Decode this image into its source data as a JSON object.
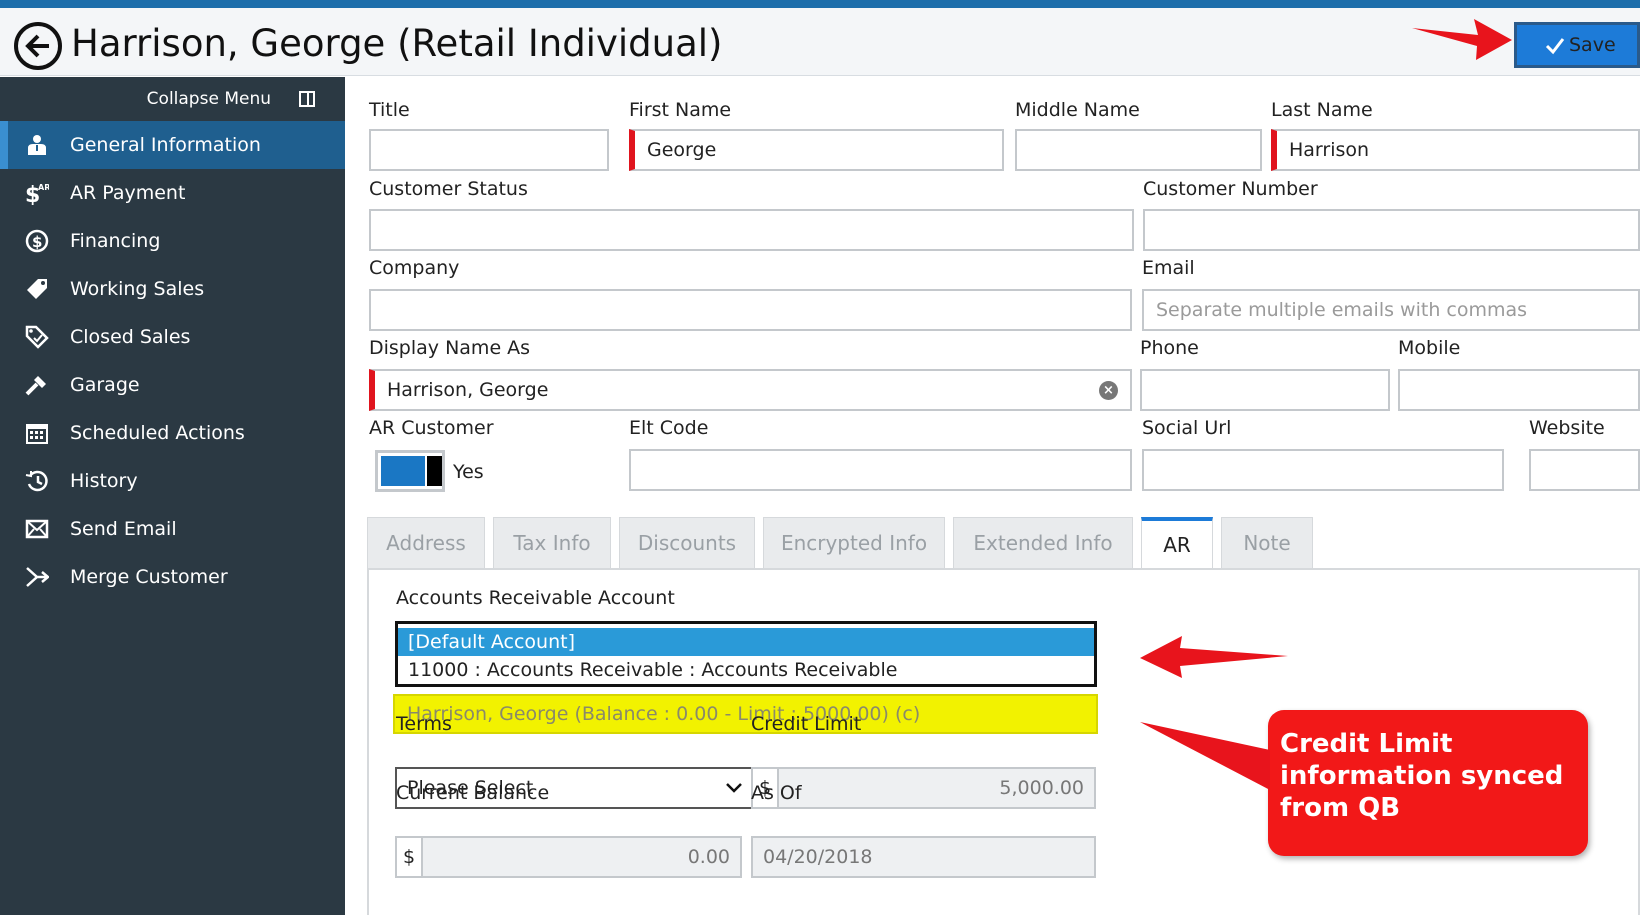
{
  "header": {
    "title": "Harrison, George (Retail Individual)",
    "save_label": "Save"
  },
  "sidebar": {
    "collapse_label": "Collapse Menu",
    "items": [
      {
        "label": "General Information",
        "icon": "person-icon",
        "active": true
      },
      {
        "label": "AR Payment",
        "icon": "ar-dollar-icon"
      },
      {
        "label": "Financing",
        "icon": "dollar-circle-icon"
      },
      {
        "label": "Working Sales",
        "icon": "tag-icon"
      },
      {
        "label": "Closed Sales",
        "icon": "tag-check-icon"
      },
      {
        "label": "Garage",
        "icon": "wrench-icon"
      },
      {
        "label": "Scheduled Actions",
        "icon": "calendar-icon"
      },
      {
        "label": "History",
        "icon": "history-icon"
      },
      {
        "label": "Send Email",
        "icon": "envelope-icon"
      },
      {
        "label": "Merge Customer",
        "icon": "merge-icon"
      }
    ]
  },
  "form": {
    "title_label": "Title",
    "title_value": "",
    "first_name_label": "First Name",
    "first_name_value": "George",
    "middle_name_label": "Middle Name",
    "middle_name_value": "",
    "last_name_label": "Last Name",
    "last_name_value": "Harrison",
    "customer_status_label": "Customer Status",
    "customer_status_value": "",
    "customer_number_label": "Customer Number",
    "customer_number_value": "",
    "company_label": "Company",
    "company_value": "",
    "email_label": "Email",
    "email_placeholder": "Separate multiple emails with commas",
    "display_name_label": "Display Name As",
    "display_name_value": "Harrison, George",
    "phone_label": "Phone",
    "phone_value": "",
    "mobile_label": "Mobile",
    "mobile_value": "",
    "ar_customer_label": "AR Customer",
    "ar_customer_value": "Yes",
    "elt_code_label": "Elt Code",
    "elt_code_value": "",
    "social_url_label": "Social Url",
    "social_url_value": "",
    "website_label": "Website",
    "website_value": ""
  },
  "tabs": [
    {
      "label": "Address"
    },
    {
      "label": "Tax Info"
    },
    {
      "label": "Discounts"
    },
    {
      "label": "Encrypted Info"
    },
    {
      "label": "Extended Info"
    },
    {
      "label": "AR",
      "active": true
    },
    {
      "label": "Note"
    }
  ],
  "ar": {
    "account_label": "Accounts Receivable Account",
    "account_options": [
      "[Default Account]",
      "11000 : Accounts Receivable : Accounts Receivable"
    ],
    "qb_customer_value": "Harrison, George (Balance : 0.00 - Limit : 5000.00) (c)",
    "terms_label": "Terms",
    "terms_value": "Please Select",
    "credit_limit_label": "Credit Limit",
    "credit_limit_currency": "$",
    "credit_limit_value": "5,000.00",
    "current_balance_label": "Current Balance",
    "current_balance_currency": "$",
    "current_balance_value": "0.00",
    "as_of_label": "As Of",
    "as_of_value": "04/20/2018"
  },
  "annotation": {
    "callout_text": "Credit Limit information synced from QB"
  },
  "colors": {
    "accent": "#1d7bd8",
    "sidebar": "#2b3943",
    "required": "#e0141e",
    "highlight": "#f2f200",
    "callout": "#f21818"
  }
}
